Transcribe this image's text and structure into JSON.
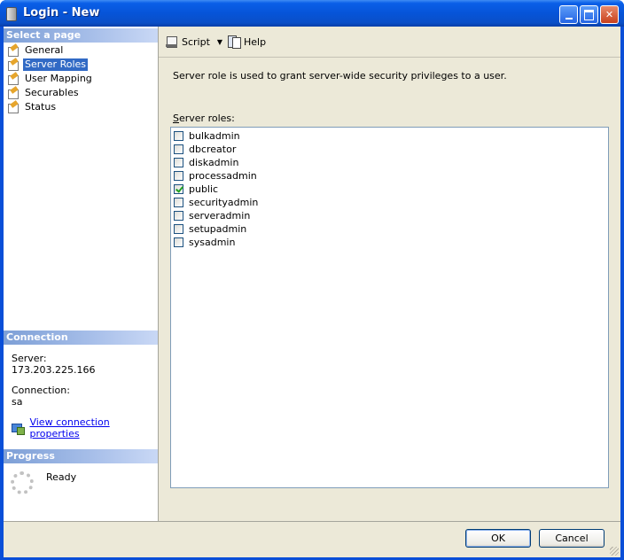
{
  "window": {
    "title": "Login - New"
  },
  "left_panel": {
    "select_page_header": "Select a page",
    "pages": [
      {
        "label": "General",
        "selected": false
      },
      {
        "label": "Server Roles",
        "selected": true
      },
      {
        "label": "User Mapping",
        "selected": false
      },
      {
        "label": "Securables",
        "selected": false
      },
      {
        "label": "Status",
        "selected": false
      }
    ],
    "connection_header": "Connection",
    "server_label": "Server:",
    "server_value": "173.203.225.166",
    "connection_label": "Connection:",
    "connection_value": "sa",
    "view_connection_link": "View connection properties",
    "progress_header": "Progress",
    "progress_status": "Ready"
  },
  "toolbar": {
    "script_label": "Script",
    "help_label": "Help"
  },
  "main": {
    "description": "Server role is used to grant server-wide security privileges to a user.",
    "roles_label_prefix": "S",
    "roles_label_rest": "erver roles:",
    "roles": [
      {
        "name": "bulkadmin",
        "checked": false
      },
      {
        "name": "dbcreator",
        "checked": false
      },
      {
        "name": "diskadmin",
        "checked": false
      },
      {
        "name": "processadmin",
        "checked": false
      },
      {
        "name": "public",
        "checked": true
      },
      {
        "name": "securityadmin",
        "checked": false
      },
      {
        "name": "serveradmin",
        "checked": false
      },
      {
        "name": "setupadmin",
        "checked": false
      },
      {
        "name": "sysadmin",
        "checked": false
      }
    ]
  },
  "buttons": {
    "ok_label": "OK",
    "cancel_label": "Cancel"
  }
}
